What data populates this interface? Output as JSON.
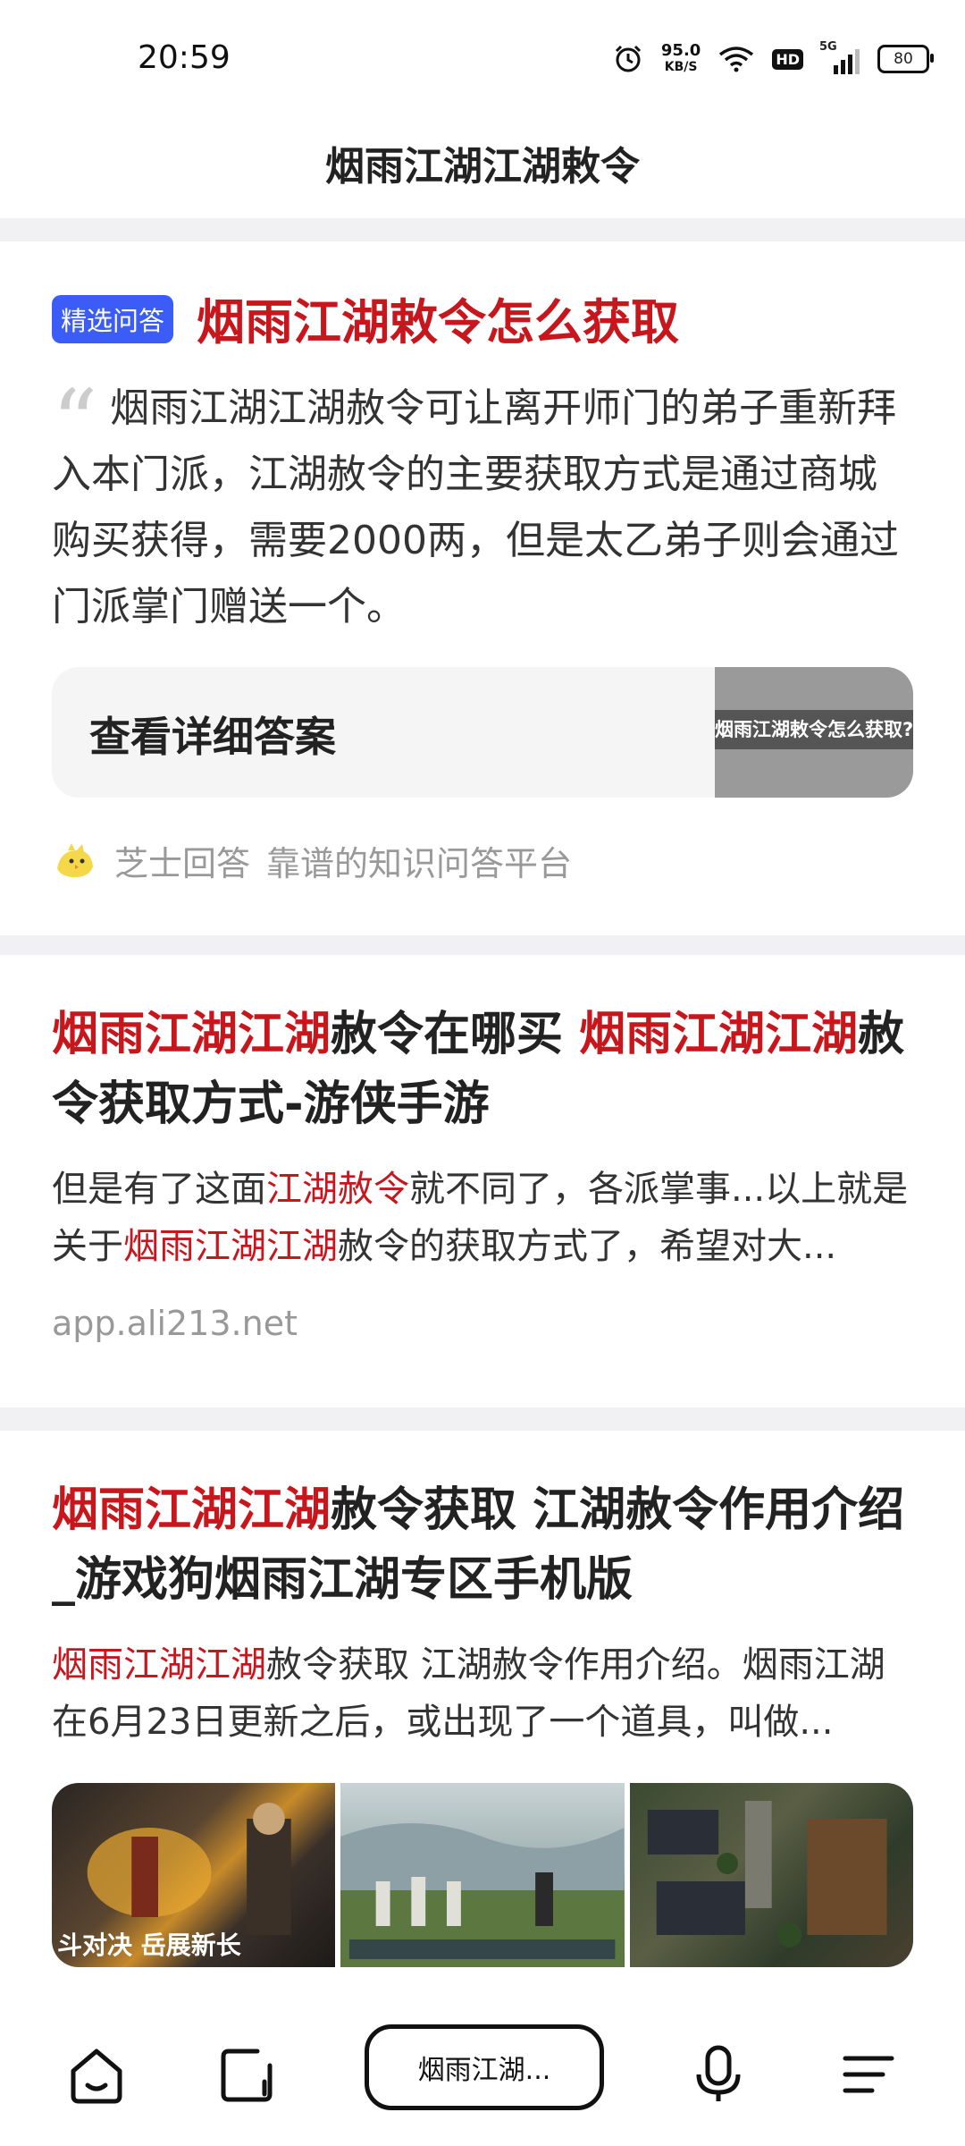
{
  "status": {
    "time": "20:59",
    "speed_value": "95.0",
    "speed_unit": "KB/S",
    "hd": "HD",
    "net": "5G",
    "battery": "80"
  },
  "header": {
    "title": "烟雨江湖江湖敕令"
  },
  "featured": {
    "badge": "精选问答",
    "title": "烟雨江湖敕令怎么获取",
    "quote_mark": "“",
    "answer": "烟雨江湖江湖赦令可让离开师门的弟子重新拜入本门派，江湖赦令的主要获取方式是通过商城购买获得，需要2000两，但是太乙弟子则会通过门派掌门赠送一个。",
    "detail_button": "查看详细答案",
    "thumb_text": "烟雨江湖敕令怎么获取?",
    "source_name": "芝士回答",
    "source_slogan": "靠谱的知识问答平台"
  },
  "results": [
    {
      "title_parts": [
        "烟雨江湖江湖",
        "赦令在哪买 ",
        "烟雨江湖江湖",
        "赦令获取方式-游侠手游"
      ],
      "desc_parts": [
        "但是有了这面",
        "江湖赦令",
        "就不同了，各派掌事...以上就是关于",
        "烟雨江湖江湖",
        "赦令的获取方式了，希望对大..."
      ],
      "url": "app.ali213.net"
    },
    {
      "title_parts": [
        "烟雨江湖江湖",
        "赦令获取 江湖赦令作用介绍_游戏狗烟雨江湖专区手机版"
      ],
      "desc_parts": [
        "烟雨江湖江湖",
        "赦令获取 江湖赦令作用介绍。烟雨江湖在6月23日更新之后，或出现了一个道具，叫做..."
      ],
      "image_caption": "斗对决 岳展新长"
    }
  ],
  "bottom_nav": {
    "search_text": "烟雨江湖..."
  }
}
